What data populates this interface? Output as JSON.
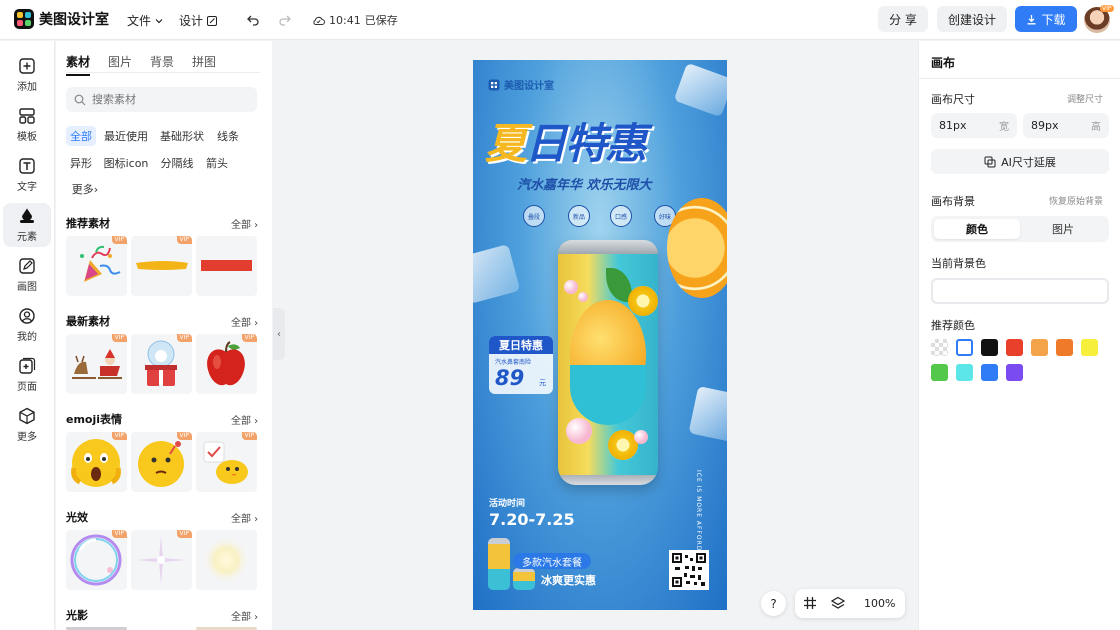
{
  "app": {
    "name": "美图设计室"
  },
  "topbar": {
    "file_menu": "文件",
    "design_menu": "设计",
    "save_time": "10:41",
    "save_status": "已保存",
    "share_label": "分 享",
    "create_design_label": "创建设计",
    "download_label": "下载",
    "avatar_badge": "VIP"
  },
  "rail": [
    {
      "key": "add",
      "label": "添加"
    },
    {
      "key": "template",
      "label": "模板"
    },
    {
      "key": "text",
      "label": "文字"
    },
    {
      "key": "element",
      "label": "元素"
    },
    {
      "key": "draw",
      "label": "画图"
    },
    {
      "key": "mine",
      "label": "我的"
    },
    {
      "key": "page",
      "label": "页面"
    },
    {
      "key": "more",
      "label": "更多"
    }
  ],
  "panel": {
    "tabs": [
      "素材",
      "图片",
      "背景",
      "拼图"
    ],
    "search_placeholder": "搜索素材",
    "chips": [
      "全部",
      "最近使用",
      "基础形状",
      "线条",
      "异形",
      "图标icon",
      "分隔线",
      "箭头",
      "更多"
    ],
    "sections": [
      {
        "title": "推荐素材",
        "all": "全部"
      },
      {
        "title": "最新素材",
        "all": "全部"
      },
      {
        "title": "emoji表情",
        "all": "全部"
      },
      {
        "title": "光效",
        "all": "全部"
      },
      {
        "title": "光影",
        "all": "全部"
      }
    ],
    "vip_label": "VIP"
  },
  "poster": {
    "brand": "美图设计室",
    "title_a": "夏",
    "title_b": "日特惠",
    "subtitle": "汽水嘉年华 欢乐无限大",
    "badges": [
      "叠段",
      "新品",
      "口感",
      "好味"
    ],
    "tag_title": "夏日特惠",
    "tag_sub": "汽水鼻套南险",
    "tag_price": "89",
    "tag_unit": "元",
    "date_label": "活动时间",
    "date": "7.20-7.25",
    "side_text": "ICE IS MORE AFFORDABLE!",
    "pill": "多款汽水套餐",
    "slogan": "冰爽更实惠"
  },
  "canvas_controls": {
    "help": "?",
    "zoom": "100%"
  },
  "right_panel": {
    "title": "画布",
    "size_label": "画布尺寸",
    "adjust_size": "调整尺寸",
    "width_value": "81px",
    "width_unit": "宽",
    "height_value": "89px",
    "height_unit": "高",
    "ai_extend": "AI尺寸延展",
    "bg_label": "画布背景",
    "restore_bg": "恢复原始背景",
    "seg_color": "颜色",
    "seg_image": "图片",
    "current_bg": "当前背景色",
    "recommended": "推荐颜色",
    "swatches": [
      "transparent",
      "#ffffff",
      "#111111",
      "#e8402a",
      "#f3a44a",
      "#ef7a2a",
      "#f6ef3c",
      "#54c84a",
      "#5de6ea",
      "#2f7cf6",
      "#7a4bf0"
    ]
  },
  "colors": {
    "accent": "#2f7cf6",
    "vip": "#f3a26a"
  }
}
